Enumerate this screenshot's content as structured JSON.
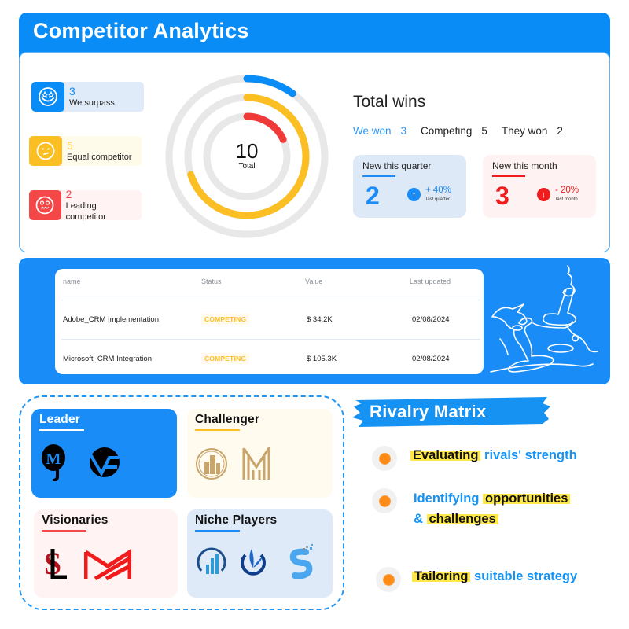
{
  "header": {
    "title": "Competitor Analytics"
  },
  "legend": [
    {
      "value": "3",
      "label": "We surpass",
      "icon": "star-eyes-face-icon",
      "color": "#0a8cf7",
      "bg": "#dfebf8"
    },
    {
      "value": "5",
      "label": "Equal competitor",
      "icon": "neutral-face-icon",
      "color": "#fbbf24",
      "bg": "#fffbea"
    },
    {
      "value": "2",
      "label": "Leading competitor",
      "icon": "worried-face-icon",
      "color": "#f44747",
      "bg": "#fff3f3"
    }
  ],
  "chart_data": {
    "type": "radial-bar",
    "title": "",
    "center_value": "10",
    "center_label": "Total",
    "series": [
      {
        "name": "We surpass",
        "ring": "outer",
        "value": 3,
        "arc_fraction": 0.1,
        "color": "#0a8cf7"
      },
      {
        "name": "Equal competitor",
        "ring": "middle",
        "value": 5,
        "arc_fraction": 0.7,
        "color": "#fbbf24"
      },
      {
        "name": "Leading competitor",
        "ring": "inner",
        "value": 2,
        "arc_fraction": 0.18,
        "color": "#f03a3a"
      }
    ],
    "track_color": "#e8e8e8"
  },
  "wins": {
    "title": "Total wins",
    "we_won_label": "We won",
    "we_won_value": "3",
    "competing_label": "Competing",
    "competing_value": "5",
    "they_won_label": "They won",
    "they_won_value": "2"
  },
  "stats": {
    "quarter": {
      "title": "New this quarter",
      "value": "2",
      "change": "+ 40%",
      "period": "last quarter",
      "direction": "up",
      "color": "#1a8cf7",
      "bg": "#dde9f7"
    },
    "month": {
      "title": "New this month",
      "value": "3",
      "change": "- 20%",
      "period": "last month",
      "direction": "down",
      "color": "#ee1c1c",
      "bg": "#fff2f2"
    }
  },
  "table": {
    "columns": [
      "name",
      "Status",
      "Value",
      "Last updated"
    ],
    "rows": [
      {
        "name": "Adobe_CRM Implementation",
        "status": "COMPETING",
        "value": "$ 34.2K",
        "updated": "02/08/2024"
      },
      {
        "name": "Microsoft_CRM Integration",
        "status": "COMPETING",
        "value": "$ 105.3K",
        "updated": "02/08/2024"
      }
    ]
  },
  "matrix": {
    "quadrants": [
      {
        "title": "Leader",
        "logos": [
          "mj-logo",
          "vs-logo"
        ]
      },
      {
        "title": "Challenger",
        "logos": [
          "building-circle-logo",
          "m-monogram-logo"
        ]
      },
      {
        "title": "Visionaries",
        "logos": [
          "sl-logo",
          "m-chevron-logo"
        ]
      },
      {
        "title": "Niche Players",
        "logos": [
          "chart-circle-logo",
          "flame-lotus-logo",
          "s-pixel-logo"
        ]
      }
    ]
  },
  "rivalry": {
    "title": "Rivalry Matrix",
    "items": [
      {
        "highlight": "Evaluating",
        "rest": " rivals' strength"
      },
      {
        "lead": "Identifying ",
        "highlight": "opportunities",
        "line2_lead": "& ",
        "line2_highlight": "challenges"
      },
      {
        "highlight": "Tailoring",
        "rest": " suitable strategy"
      }
    ]
  }
}
